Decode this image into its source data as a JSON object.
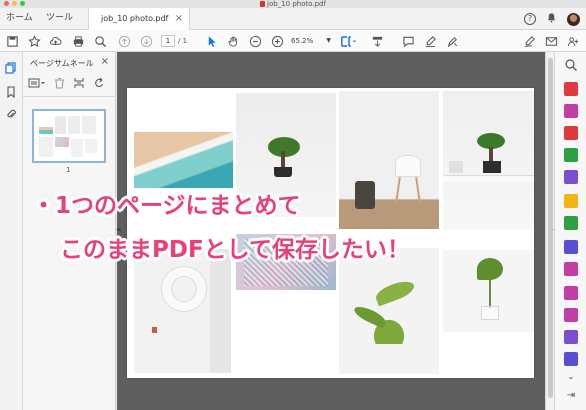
{
  "window": {
    "title": "job_10 photo.pdf"
  },
  "tabs": {
    "home": "ホーム",
    "tools": "ツール",
    "document": "job_10 photo.pdf"
  },
  "toolbar": {
    "page_current": "1",
    "page_total": "/ 1",
    "zoom": "65.2%"
  },
  "panel": {
    "title": "ページサムネール",
    "thumbnail_page_number": "1"
  },
  "overlay": {
    "line1": "・1つのページにまとめて",
    "line2": "このままPDFとして保存したい！"
  },
  "colors": {
    "accent_pink": "#e8407a",
    "selection_blue": "#8fb4d6",
    "doc_background": "#5f5f5f",
    "toolbar_blue": "#1473e6"
  },
  "icons": {
    "right_rail": [
      "create-pdf-icon",
      "edit-pdf-icon",
      "export-pdf-icon",
      "organize-pages-icon",
      "combine-files-icon",
      "comment-icon",
      "enhance-scans-icon",
      "protect-icon",
      "fill-sign-icon",
      "print-production-icon",
      "prepare-form-icon",
      "more-tools-icon",
      "collapse-icon"
    ]
  }
}
